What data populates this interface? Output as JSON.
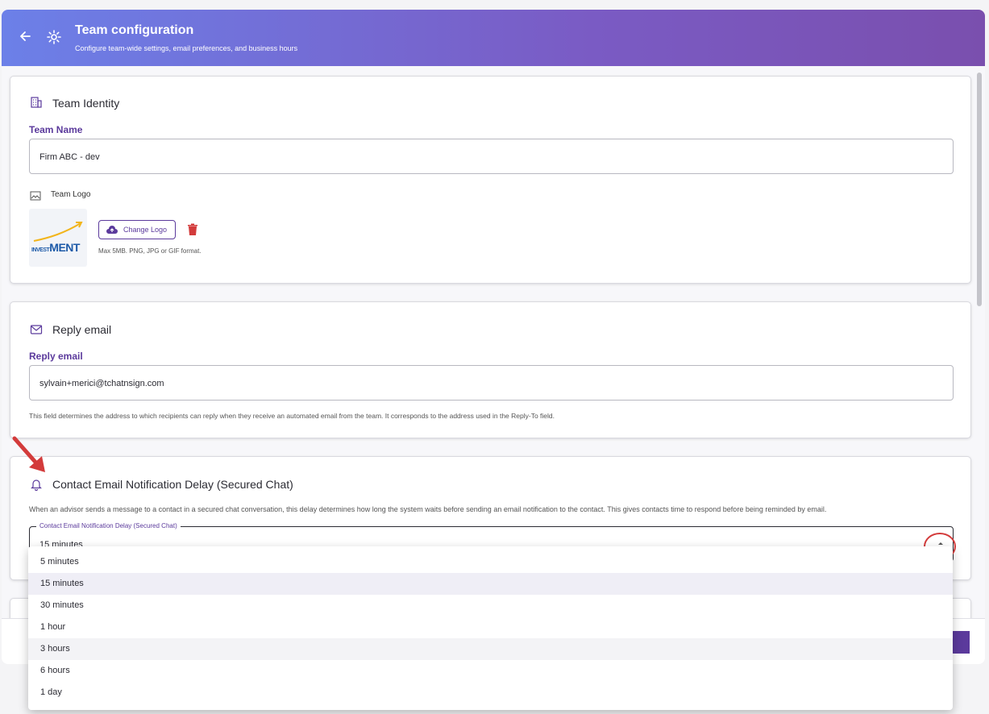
{
  "header": {
    "title": "Team configuration",
    "subtitle": "Configure team-wide settings, email preferences, and business hours"
  },
  "identity": {
    "title": "Team Identity",
    "team_name_label": "Team Name",
    "team_name_value": "Firm ABC - dev",
    "logo_label": "Team Logo",
    "logo_word_small": "INVEST",
    "logo_word_big": "MENT",
    "change_logo_label": "Change Logo",
    "logo_help": "Max 5MB. PNG, JPG or GIF format."
  },
  "reply": {
    "title": "Reply email",
    "label": "Reply email",
    "value": "sylvain+merici@tchatnsign.com",
    "help": "This field determines the address to which recipients can reply when they receive an automated email from the team. It corresponds to the address used in the Reply-To field."
  },
  "delay": {
    "title": "Contact Email Notification Delay (Secured Chat)",
    "description": "When an advisor sends a message to a contact in a secured chat conversation, this delay determines how long the system waits before sending an email notification to the contact. This gives contacts time to respond before being reminded by email.",
    "select_label": "Contact Email Notification Delay (Secured Chat)",
    "selected": "15 minutes",
    "options": [
      "5 minutes",
      "15 minutes",
      "30 minutes",
      "1 hour",
      "3 hours",
      "6 hours",
      "1 day"
    ]
  },
  "colors": {
    "accent": "#5b3a9c",
    "annotation": "#d33b3b"
  }
}
